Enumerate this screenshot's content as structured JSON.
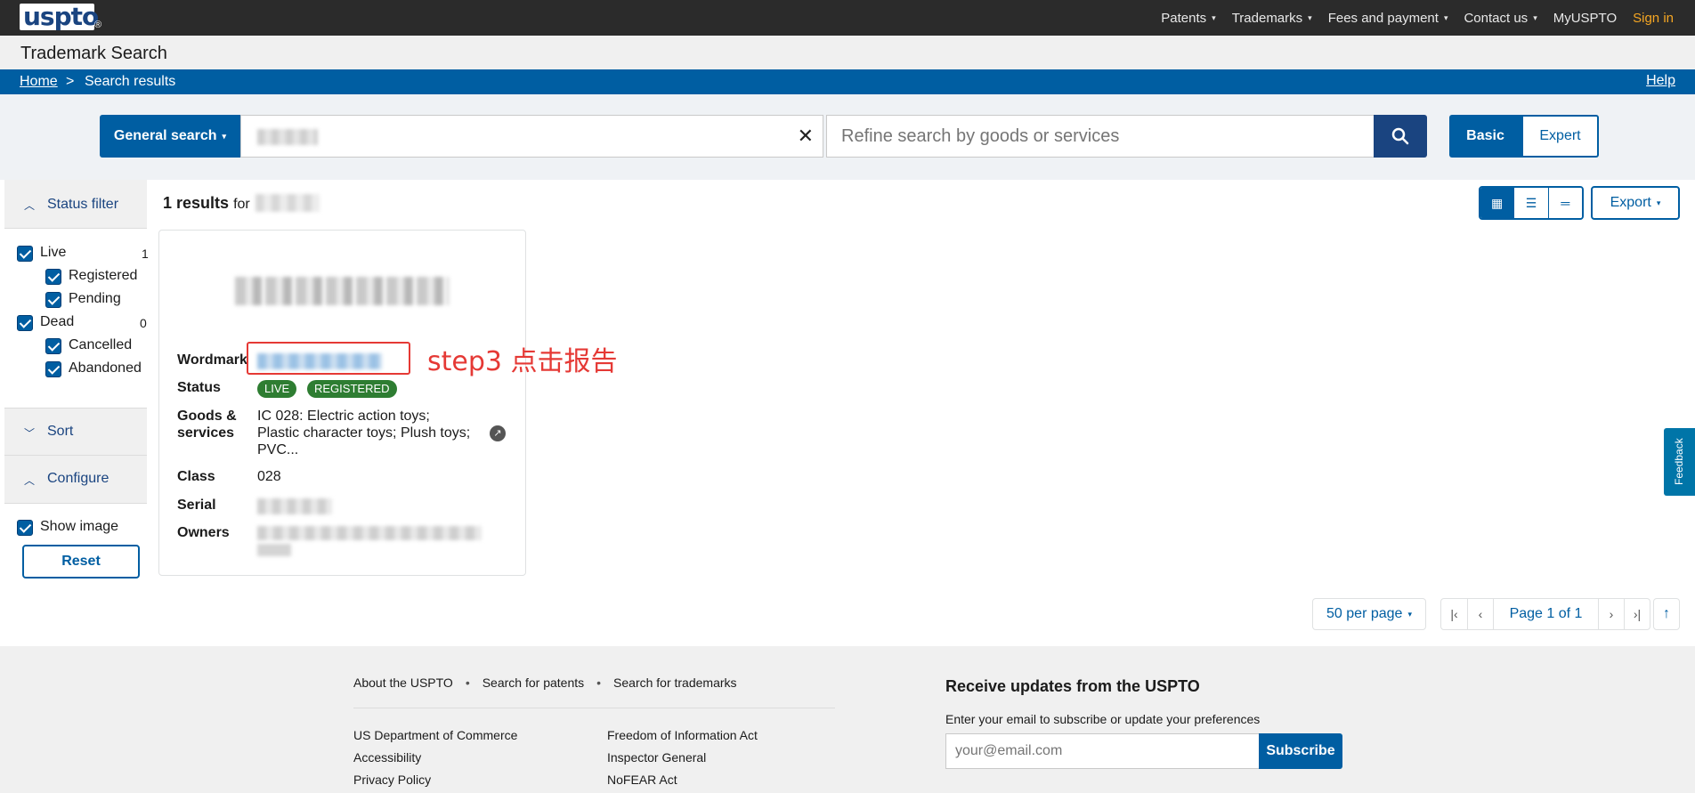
{
  "topbar": {
    "logo": "uspto",
    "logo_reg": "®",
    "nav": [
      {
        "label": "Patents",
        "has_menu": true
      },
      {
        "label": "Trademarks",
        "has_menu": true
      },
      {
        "label": "Fees and payment",
        "has_menu": true
      },
      {
        "label": "Contact us",
        "has_menu": true
      },
      {
        "label": "MyUSPTO",
        "has_menu": false
      },
      {
        "label": "Sign in",
        "has_menu": false
      }
    ],
    "caret": "▾"
  },
  "app_title": "Trademark Search",
  "breadcrumb": {
    "home": "Home",
    "separator": ">",
    "current": "Search results",
    "help": "Help"
  },
  "search": {
    "type_label": "General search",
    "term_value": "",
    "clear_icon": "✕",
    "refine_placeholder": "Refine search by goods or services",
    "mode_basic": "Basic",
    "mode_expert": "Expert"
  },
  "sidebar": {
    "status_filter_label": "Status filter",
    "filters": [
      {
        "label": "Live",
        "count": "1",
        "checked": true
      },
      {
        "label": "Registered",
        "checked": true
      },
      {
        "label": "Pending",
        "checked": true
      },
      {
        "label": "Dead",
        "count": "0",
        "checked": true
      },
      {
        "label": "Cancelled",
        "checked": true
      },
      {
        "label": "Abandoned",
        "checked": true
      }
    ],
    "sort_label": "Sort",
    "configure_label": "Configure",
    "show_image_label": "Show image",
    "reset_label": "Reset"
  },
  "results": {
    "count_text": "1 results",
    "for_text": "for",
    "card": {
      "wordmark_label": "Wordmark",
      "status_label": "Status",
      "status_badges": [
        "LIVE",
        "REGISTERED"
      ],
      "goods_label_1": "Goods &",
      "goods_label_2": "services",
      "goods_line_1": "IC 028: Electric action toys;",
      "goods_line_2": "Plastic character toys; Plush toys;",
      "goods_line_3": "PVC...",
      "class_label": "Class",
      "class_value": "028",
      "serial_label": "Serial",
      "owners_label": "Owners"
    }
  },
  "annotation": {
    "text": "step3 点击报告",
    "color": "#e53935"
  },
  "toolbar": {
    "view_icons": [
      "▦",
      "☰",
      "═"
    ],
    "export_label": "Export"
  },
  "pagination": {
    "per_page": "50 per page",
    "first": "|‹",
    "prev": "‹",
    "page_label": "Page 1 of 1",
    "next": "›",
    "last": "›|",
    "to_top": "↑"
  },
  "feedback_label": "Feedback",
  "footer": {
    "top_links": [
      "About the USPTO",
      "Search for patents",
      "Search for trademarks"
    ],
    "col1": [
      "US Department of Commerce",
      "Accessibility",
      "Privacy Policy"
    ],
    "col2": [
      "Freedom of Information Act",
      "Inspector General",
      "NoFEAR Act"
    ],
    "receive_title": "Receive updates from the USPTO",
    "receive_desc": "Enter your email to subscribe or update your preferences",
    "email_placeholder": "your@email.com",
    "subscribe_label": "Subscribe"
  },
  "colors": {
    "brand_blue": "#005ea2",
    "dark_blue": "#1a4480",
    "live_green": "#2e7d32",
    "signin_orange": "#f5a623"
  }
}
